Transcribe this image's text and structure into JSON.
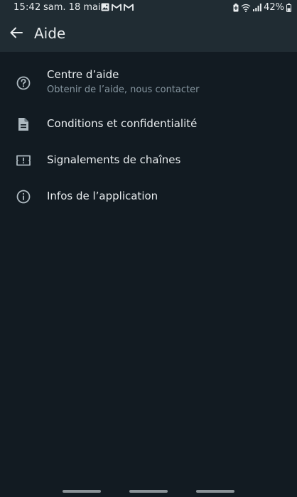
{
  "status_bar": {
    "time": "15:42",
    "date": "sam. 18 mai",
    "battery": "42%",
    "notif_icons": [
      "gallery-icon",
      "gmail-icon",
      "gmail-icon"
    ],
    "system_icons": [
      "battery-saver-icon",
      "wifi-icon",
      "signal-icon",
      "battery-icon"
    ]
  },
  "app_bar": {
    "back_icon": "arrow-left-icon",
    "title": "Aide"
  },
  "menu": {
    "items": [
      {
        "icon": "help-circle-icon",
        "title": "Centre d’aide",
        "subtitle": "Obtenir de l’aide, nous contacter"
      },
      {
        "icon": "document-icon",
        "title": "Conditions et confidentialité"
      },
      {
        "icon": "report-icon",
        "title": "Signalements de chaînes"
      },
      {
        "icon": "info-icon",
        "title": "Infos de l’application"
      }
    ]
  },
  "colors": {
    "background": "#121b22",
    "header": "#202c33",
    "primary_text": "#e9edef",
    "secondary_text": "#8696a0",
    "icon": "#aebac1"
  }
}
